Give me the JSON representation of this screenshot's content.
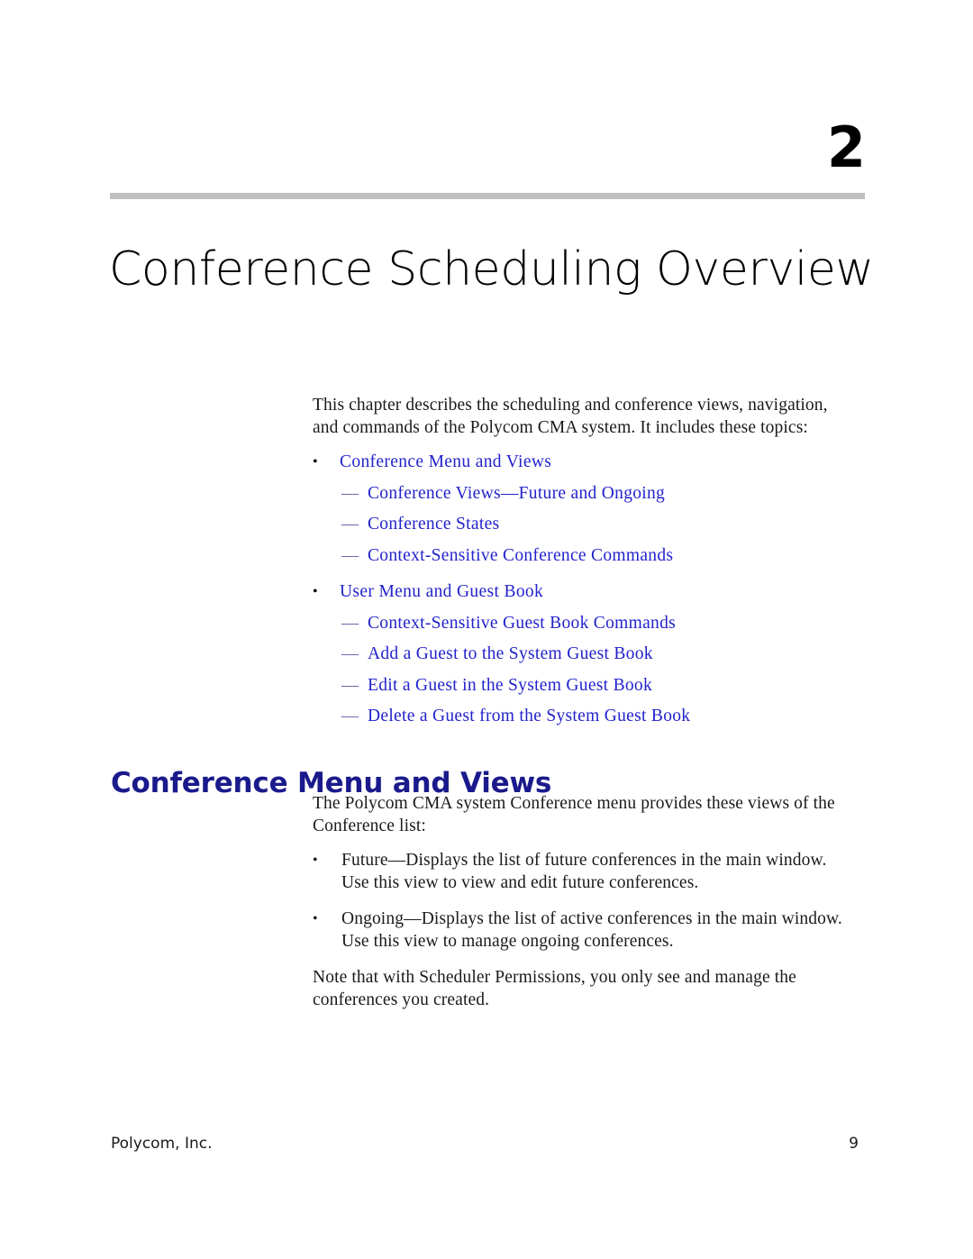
{
  "chapter": {
    "number": "2",
    "title": "Conference Scheduling Overview"
  },
  "intro": {
    "paragraph": "This chapter describes the scheduling and conference views, navigation, and commands of the Polycom CMA system. It includes these topics:"
  },
  "toc": {
    "groups": [
      {
        "bullet": "•",
        "label": "Conference Menu and Views",
        "children": [
          {
            "dash": "—",
            "label": "Conference Views—Future and Ongoing"
          },
          {
            "dash": "—",
            "label": "Conference States"
          },
          {
            "dash": "—",
            "label": "Context-Sensitive Conference Commands"
          }
        ]
      },
      {
        "bullet": "•",
        "label": "User Menu and Guest Book",
        "children": [
          {
            "dash": "—",
            "label": "Context-Sensitive Guest Book Commands"
          },
          {
            "dash": "—",
            "label": "Add a Guest to the System Guest Book"
          },
          {
            "dash": "—",
            "label": "Edit a Guest in the System Guest Book"
          },
          {
            "dash": "—",
            "label": "Delete a Guest from the System Guest Book"
          }
        ]
      }
    ]
  },
  "section": {
    "heading": "Conference Menu and Views",
    "intro": "The Polycom CMA system Conference menu provides these views of the Conference list:",
    "bullets": [
      {
        "bullet": "•",
        "text": "Future—Displays the list of future conferences in the main window. Use this view to view and edit future conferences."
      },
      {
        "bullet": "•",
        "text": "Ongoing—Displays the list of active conferences in the main window. Use this view to manage ongoing conferences."
      }
    ],
    "note": "Note that with Scheduler Permissions, you only see and manage the conferences you created."
  },
  "footer": {
    "company": "Polycom, Inc.",
    "page_number": "9"
  },
  "colors": {
    "link": "#2222cc",
    "heading": "#1a1a8c",
    "rule": "#c0c0c0",
    "body_text": "#1a1a1a"
  }
}
